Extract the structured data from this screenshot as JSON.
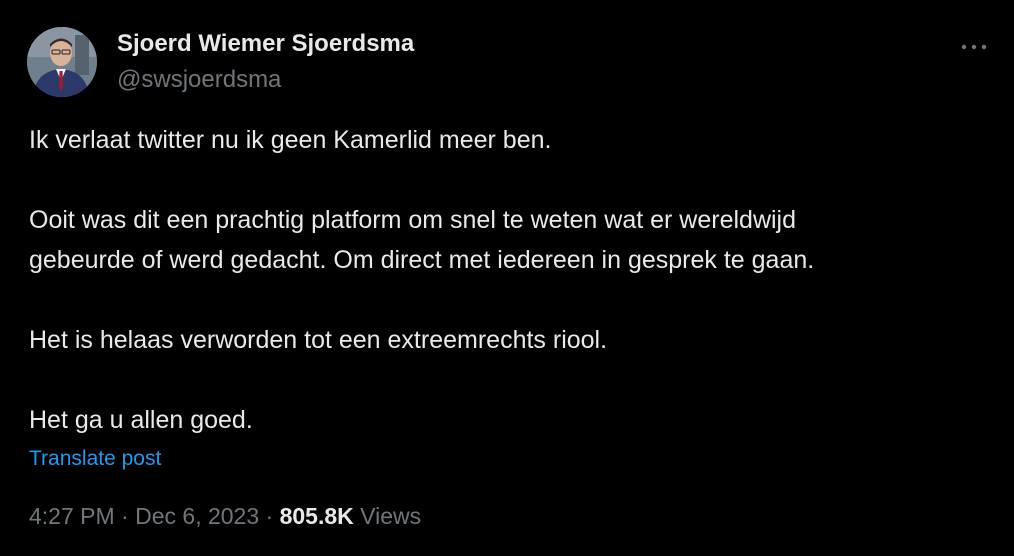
{
  "author": {
    "name": "Sjoerd Wiemer Sjoerdsma",
    "handle": "@swsjoerdsma",
    "avatar_icon": "profile-photo"
  },
  "more_icon": "more-dots-icon",
  "tweet": {
    "paragraphs": [
      [
        "Ik verlaat twitter nu ik geen Kamerlid meer ben."
      ],
      [
        "Ooit was dit een prachtig platform om snel te weten wat er wereldwijd",
        "gebeurde of werd gedacht. Om direct met iedereen in gesprek te gaan."
      ],
      [
        "Het is helaas verworden tot een extreemrechts riool."
      ],
      [
        "Het ga u allen goed."
      ]
    ]
  },
  "translate_label": "Translate post",
  "meta": {
    "time": "4:27 PM",
    "separator": "·",
    "date": "Dec 6, 2023",
    "views_count": "805.8K",
    "views_label": "Views"
  },
  "colors": {
    "background": "#000000",
    "text": "#e7e9ea",
    "secondary": "#71767b",
    "link": "#1d9bf0"
  }
}
